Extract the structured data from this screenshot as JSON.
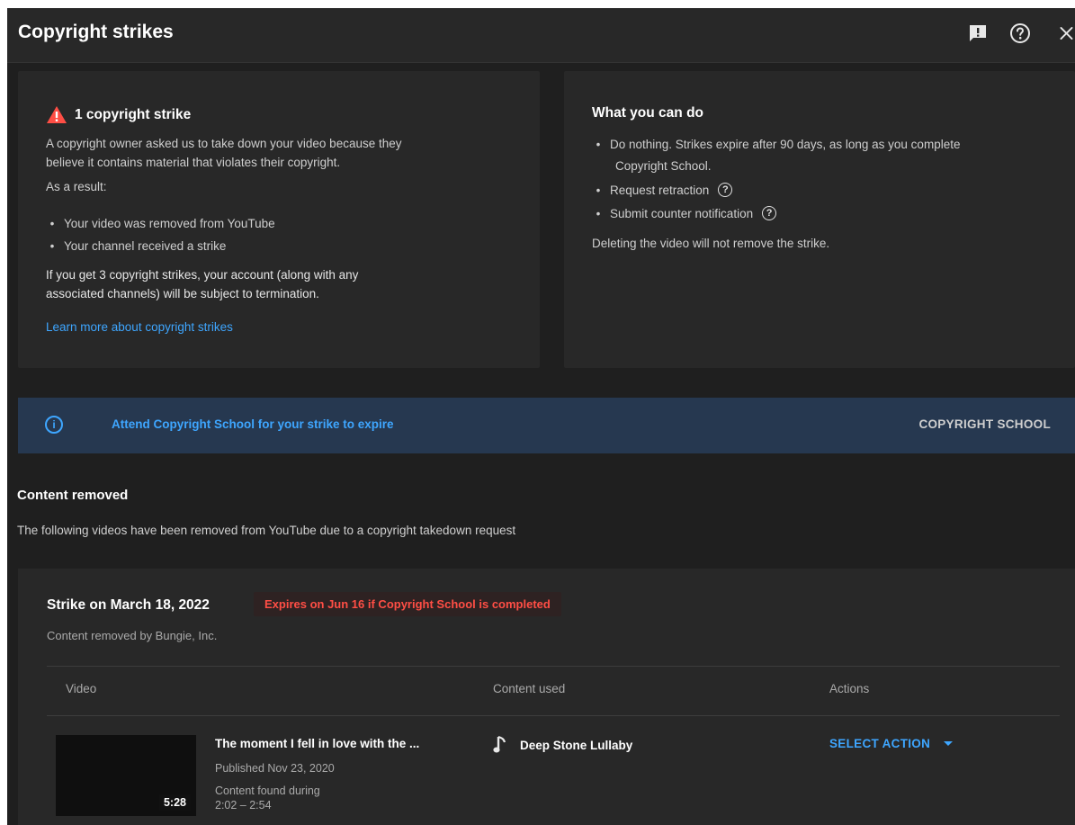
{
  "header": {
    "title": "Copyright strikes"
  },
  "strike_info": {
    "heading": "1 copyright strike",
    "desc_line1": "A copyright owner asked us to take down your video because they",
    "desc_line2": "believe it contains material that violates their copyright.",
    "result_label": "As a result:",
    "results": [
      "Your video was removed from YouTube",
      "Your channel received a strike"
    ],
    "warning_line1": "If you get 3 copyright strikes, your account (along with any",
    "warning_line2": "associated channels) will be subject to termination.",
    "learn_more": "Learn more about copyright strikes"
  },
  "what_to_do": {
    "heading": "What you can do",
    "options": [
      "Do nothing. Strikes expire after 90 days, as long as you complete",
      "Copyright School.",
      "Request retraction",
      "Submit counter notification"
    ],
    "note": "Deleting the video will not remove the strike."
  },
  "banner": {
    "text": "Attend Copyright School for your strike to expire",
    "button": "COPYRIGHT SCHOOL"
  },
  "content_removed": {
    "title": "Content removed",
    "description": "The following videos have been removed from YouTube due to a copyright takedown request"
  },
  "strike": {
    "date": "Strike on March 18, 2022",
    "expires": "Expires on Jun 16 if Copyright School is completed",
    "removed_by": "Content removed by Bungie, Inc.",
    "columns": {
      "video": "Video",
      "content_used": "Content used",
      "actions": "Actions"
    },
    "video": {
      "title": "The moment I fell in love with the ...",
      "published": "Published Nov 23, 2020",
      "found_during": "Content found during",
      "time_range": "2:02 – 2:54",
      "duration": "5:28"
    },
    "content_used": "Deep Stone Lullaby",
    "action_label": "SELECT ACTION"
  },
  "colors": {
    "background": "#1f1f1f",
    "card": "#282828",
    "link": "#3ea6ff",
    "warning": "#ff4e45",
    "banner": "#263850"
  },
  "icons": {
    "feedback": "feedback-icon",
    "help": "help-icon",
    "close": "close-icon",
    "warning": "warning-triangle-icon",
    "info": "info-icon",
    "music": "music-note-icon",
    "dropdown": "caret-down-icon"
  }
}
